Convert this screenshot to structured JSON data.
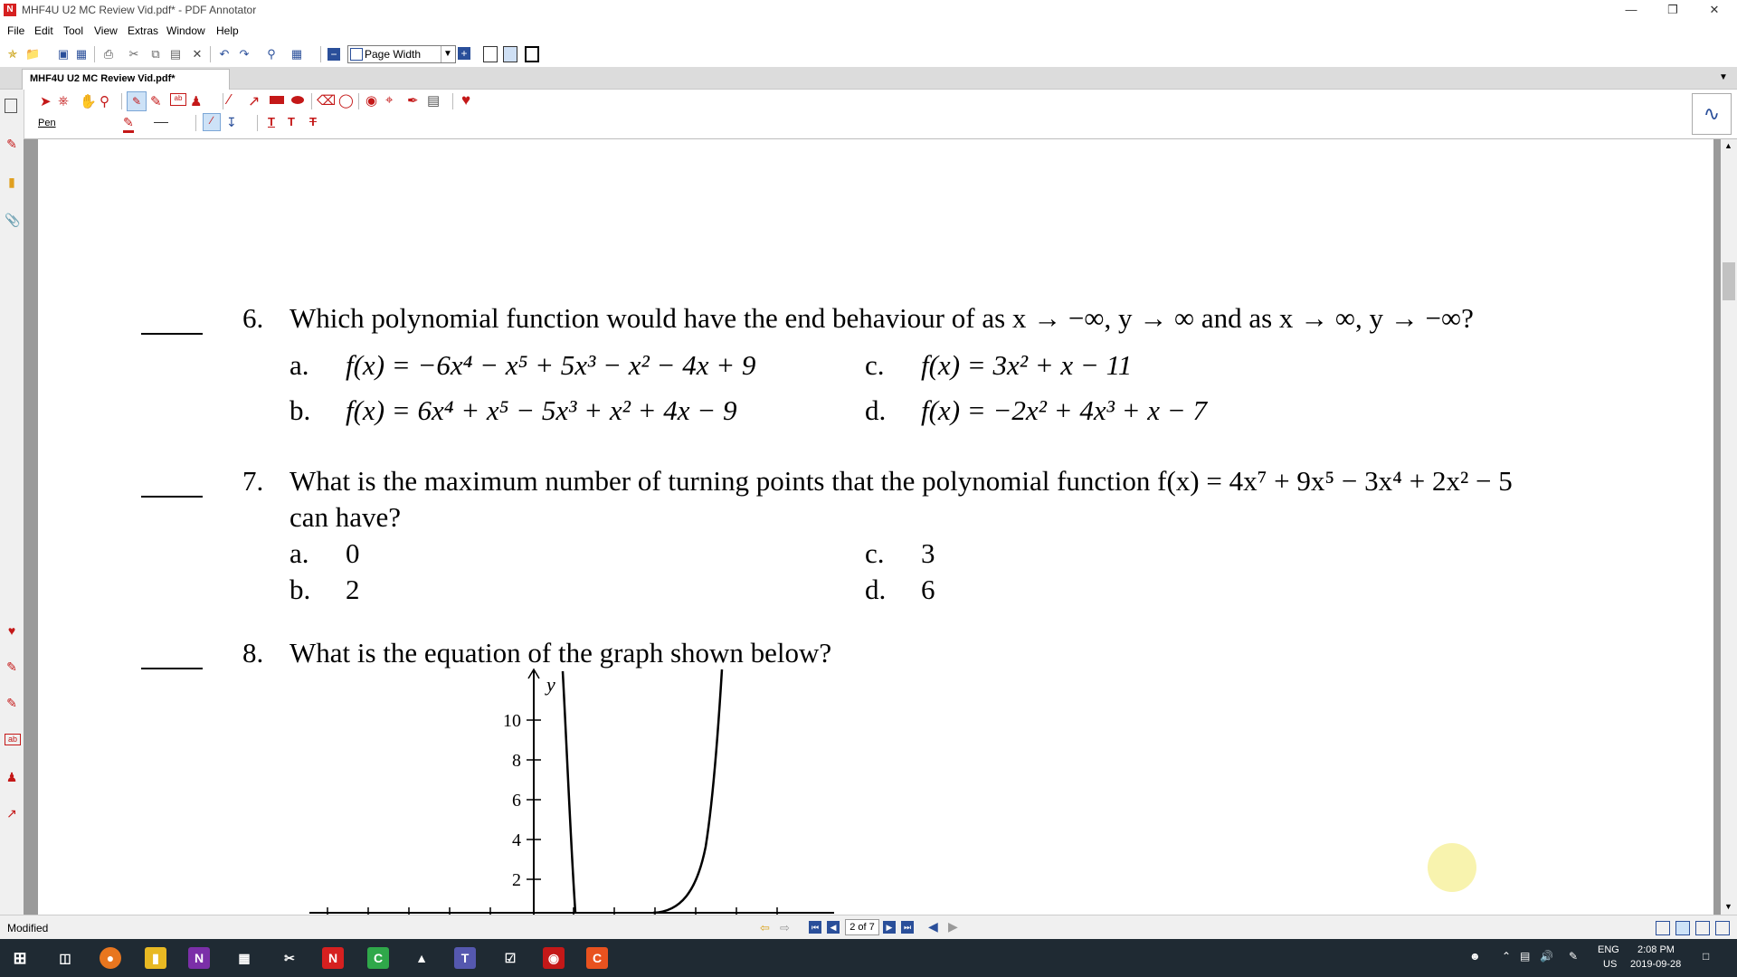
{
  "window": {
    "title": "MHF4U U2 MC Review Vid.pdf* - PDF Annotator",
    "app_icon": "pdf-annotator-icon",
    "controls": [
      "minimize-icon",
      "restore-icon",
      "close-icon"
    ]
  },
  "menu": [
    "File",
    "Edit",
    "Tool",
    "View",
    "Extras",
    "Window",
    "Help"
  ],
  "toolbar": {
    "zoom_mode": "Page Width"
  },
  "tabs": [
    {
      "label": "MHF4U U2 MC Review Vid.pdf*",
      "active": true
    }
  ],
  "ribbon": {
    "active_tool_label": "Pen"
  },
  "document": {
    "questions": [
      {
        "number": "6.",
        "text": "Which polynomial function would have the end behaviour of as x → −∞, y → ∞ and as x → ∞, y → −∞?",
        "options": [
          {
            "letter": "a.",
            "value": "f(x) = −6x⁴ − x⁵ + 5x³ − x² − 4x + 9"
          },
          {
            "letter": "b.",
            "value": "f(x) = 6x⁴ + x⁵ − 5x³ + x² + 4x − 9"
          },
          {
            "letter": "c.",
            "value": "f(x) = 3x² + x − 11"
          },
          {
            "letter": "d.",
            "value": "f(x) = −2x² + 4x³ + x − 7"
          }
        ]
      },
      {
        "number": "7.",
        "text": "What is the maximum number of turning points that the polynomial function f(x) = 4x⁷ + 9x⁵ − 3x⁴ + 2x² − 5",
        "text_cont": "can have?",
        "options": [
          {
            "letter": "a.",
            "value": "0"
          },
          {
            "letter": "b.",
            "value": "2"
          },
          {
            "letter": "c.",
            "value": "3"
          },
          {
            "letter": "d.",
            "value": "6"
          }
        ]
      },
      {
        "number": "8.",
        "text": "What is the equation of the graph shown below?"
      }
    ],
    "graph": {
      "y_axis_label": "y",
      "y_ticks": [
        "10",
        "8",
        "6",
        "4",
        "2"
      ]
    }
  },
  "status": {
    "left_text": "Modified",
    "page_indicator": "2 of 7"
  },
  "taskbar": {
    "language": "ENG",
    "region": "US",
    "time": "2:08 PM",
    "date": "2019-09-28"
  },
  "colors": {
    "taskbar_bg": "#1f2a33",
    "accent_red": "#d62020",
    "cursor_highlight": "#f7f1a0"
  }
}
